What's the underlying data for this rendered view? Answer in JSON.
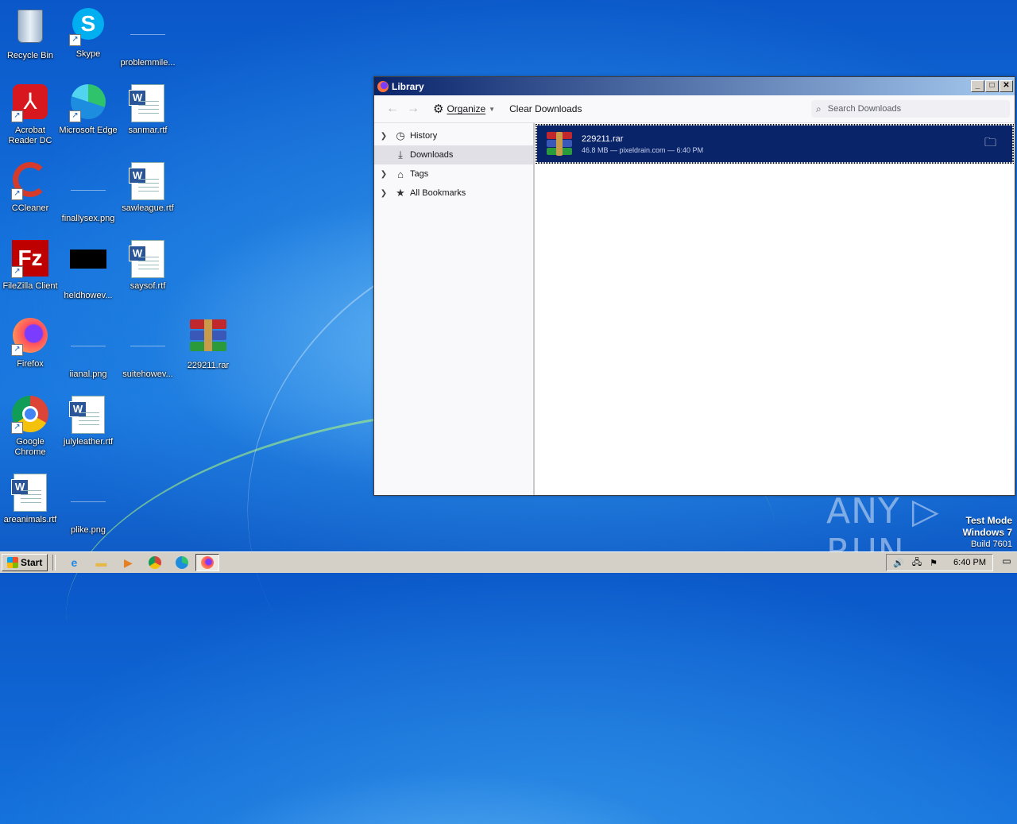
{
  "desktop": {
    "icons": [
      {
        "label": "Recycle Bin"
      },
      {
        "label": "Skype"
      },
      {
        "label": "problemmile..."
      },
      {
        "label": "Acrobat Reader DC"
      },
      {
        "label": "Microsoft Edge"
      },
      {
        "label": "sanmar.rtf"
      },
      {
        "label": "CCleaner"
      },
      {
        "label": "finallysex.png"
      },
      {
        "label": "sawleague.rtf"
      },
      {
        "label": "FileZilla Client"
      },
      {
        "label": "heldhowev..."
      },
      {
        "label": "saysof.rtf"
      },
      {
        "label": "Firefox"
      },
      {
        "label": "iianal.png"
      },
      {
        "label": "suitehowev..."
      },
      {
        "label": "229211.rar"
      },
      {
        "label": "Google Chrome"
      },
      {
        "label": "julyleather.rtf"
      },
      {
        "label": "areanimals.rtf"
      },
      {
        "label": "plike.png"
      }
    ]
  },
  "window": {
    "title": "Library",
    "toolbar": {
      "organize_label": "Organize",
      "clear_label": "Clear Downloads",
      "search_placeholder": "Search Downloads"
    },
    "sidebar": [
      {
        "label": "History",
        "icon": "clock-icon"
      },
      {
        "label": "Downloads",
        "icon": "download-icon"
      },
      {
        "label": "Tags",
        "icon": "tag-icon"
      },
      {
        "label": "All Bookmarks",
        "icon": "star-icon"
      }
    ],
    "downloads": [
      {
        "name": "229211.rar",
        "meta": "46.8 MB — pixeldrain.com — 6:40 PM"
      }
    ]
  },
  "watermark": {
    "brand": "ANY ▷ RUN",
    "mode": "Test Mode",
    "os": "Windows 7",
    "build": "Build 7601"
  },
  "taskbar": {
    "start_label": "Start",
    "clock": "6:40 PM"
  }
}
